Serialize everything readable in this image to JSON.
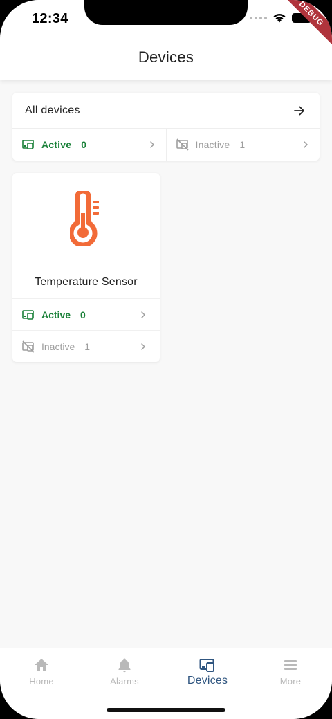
{
  "status_bar": {
    "time": "12:34",
    "debug_label": "DEBUG"
  },
  "app_bar": {
    "title": "Devices"
  },
  "all_devices": {
    "title": "All devices",
    "active": {
      "label": "Active",
      "count": "0"
    },
    "inactive": {
      "label": "Inactive",
      "count": "1"
    }
  },
  "device_cards": [
    {
      "name": "Temperature Sensor",
      "icon": "thermometer-icon",
      "active": {
        "label": "Active",
        "count": "0"
      },
      "inactive": {
        "label": "Inactive",
        "count": "1"
      }
    }
  ],
  "bottom_nav": [
    {
      "label": "Home",
      "icon": "home-icon",
      "selected": false
    },
    {
      "label": "Alarms",
      "icon": "bell-icon",
      "selected": false
    },
    {
      "label": "Devices",
      "icon": "devices-icon",
      "selected": true
    },
    {
      "label": "More",
      "icon": "menu-icon",
      "selected": false
    }
  ],
  "colors": {
    "active": "#198038",
    "inactive": "#9e9e9e",
    "accent": "#305680",
    "icon_orange": "#f26b38",
    "nav_inactive": "#b9b9b9"
  }
}
